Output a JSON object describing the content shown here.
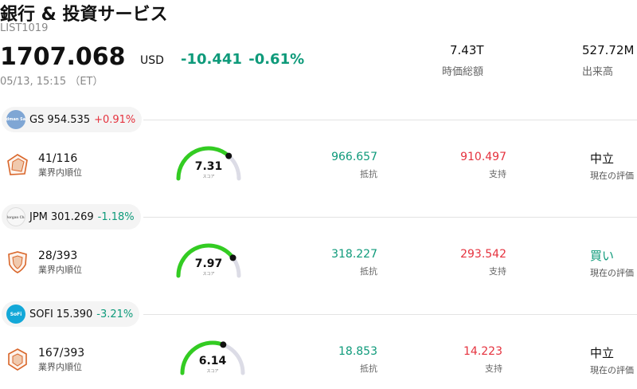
{
  "header": {
    "title": "銀行 & 投資サービス",
    "code": "LIST1019",
    "price": "1707.068",
    "currency": "USD",
    "change": "-10.441",
    "change_pct": "-0.61%",
    "timestamp": "05/13, 15:15 （ET）",
    "market_cap_value": "7.43T",
    "market_cap_label": "時価総額",
    "volume_value": "527.72M",
    "volume_label": "出来高"
  },
  "colors": {
    "positive": "#e5323e",
    "negative": "#0e9a7a",
    "gauge_fill": "#33cc22",
    "gauge_track": "#dcdce6"
  },
  "labels": {
    "rank": "業界内順位",
    "gauge_score": "スコア",
    "resistance": "抵抗",
    "support": "支持",
    "evaluation": "現在の評価"
  },
  "stocks": [
    {
      "symbol": "GS",
      "price": "954.535",
      "change_pct": "+0.91%",
      "direction": "up",
      "logo_icon": "goldman-sachs-logo",
      "logo_text": "Goldman Sachs",
      "rank": "41/116",
      "score": "7.31",
      "resistance": "966.657",
      "support": "910.497",
      "evaluation": "中立"
    },
    {
      "symbol": "JPM",
      "price": "301.269",
      "change_pct": "-1.18%",
      "direction": "down",
      "logo_icon": "jpmorgan-logo",
      "logo_text": "JPMorgan Chase",
      "rank": "28/393",
      "score": "7.97",
      "resistance": "318.227",
      "support": "293.542",
      "evaluation": "買い"
    },
    {
      "symbol": "SOFI",
      "price": "15.390",
      "change_pct": "-3.21%",
      "direction": "down",
      "logo_icon": "sofi-logo",
      "logo_text": "SoFi",
      "rank": "167/393",
      "score": "6.14",
      "resistance": "18.853",
      "support": "14.223",
      "evaluation": "中立"
    }
  ]
}
